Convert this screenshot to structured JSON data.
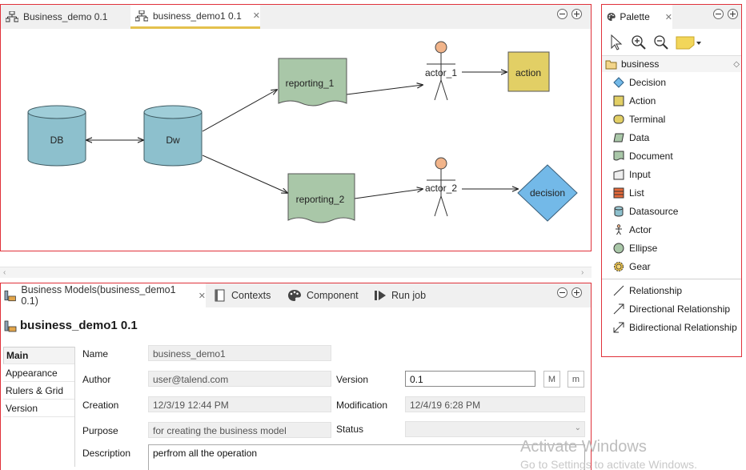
{
  "editor": {
    "tabs": [
      {
        "label": "Business_demo 0.1"
      },
      {
        "label": "business_demo1 0.1"
      }
    ],
    "diagram": {
      "db": "DB",
      "dw": "Dw",
      "reporting1": "reporting_1",
      "reporting2": "reporting_2",
      "actor1": "actor_1",
      "actor2": "actor_2",
      "action": "action",
      "decision": "decision"
    }
  },
  "palette": {
    "title": "Palette",
    "drawer": "business",
    "items": [
      {
        "label": "Decision",
        "icon": "decision-icon"
      },
      {
        "label": "Action",
        "icon": "action-icon"
      },
      {
        "label": "Terminal",
        "icon": "terminal-icon"
      },
      {
        "label": "Data",
        "icon": "data-icon"
      },
      {
        "label": "Document",
        "icon": "document-icon"
      },
      {
        "label": "Input",
        "icon": "input-icon"
      },
      {
        "label": "List",
        "icon": "list-icon"
      },
      {
        "label": "Datasource",
        "icon": "datasource-icon"
      },
      {
        "label": "Actor",
        "icon": "actor-icon"
      },
      {
        "label": "Ellipse",
        "icon": "ellipse-icon"
      },
      {
        "label": "Gear",
        "icon": "gear-icon"
      }
    ],
    "relations": [
      {
        "label": "Relationship"
      },
      {
        "label": "Directional Relationship"
      },
      {
        "label": "Bidirectional Relationship"
      }
    ]
  },
  "props": {
    "tabs": [
      {
        "label": "Business Models(business_demo1 0.1)"
      },
      {
        "label": "Contexts"
      },
      {
        "label": "Component"
      },
      {
        "label": "Run job"
      }
    ],
    "title": "business_demo1 0.1",
    "side_tabs": [
      "Main",
      "Appearance",
      "Rulers & Grid",
      "Version"
    ],
    "fields": {
      "name_label": "Name",
      "name_value": "business_demo1",
      "author_label": "Author",
      "author_value": "user@talend.com",
      "version_label": "Version",
      "version_value": "0.1",
      "major_btn": "M",
      "minor_btn": "m",
      "creation_label": "Creation",
      "creation_value": "12/3/19 12:44 PM",
      "modification_label": "Modification",
      "modification_value": "12/4/19 6:28 PM",
      "purpose_label": "Purpose",
      "purpose_value": "for creating the business model",
      "status_label": "Status",
      "status_value": "",
      "description_label": "Description",
      "description_value": "perfrom all the operation"
    }
  },
  "watermark": {
    "line1": "Activate Windows",
    "line2": "Go to Settings to activate Windows."
  },
  "colors": {
    "panel_border": "#e0313a",
    "cylinder": "#8dc0cd",
    "document": "#a9c7a8",
    "action": "#e2cf65",
    "decision": "#73b9e8",
    "actor_head": "#f1b48a",
    "active_tab": "#e4c14d"
  }
}
